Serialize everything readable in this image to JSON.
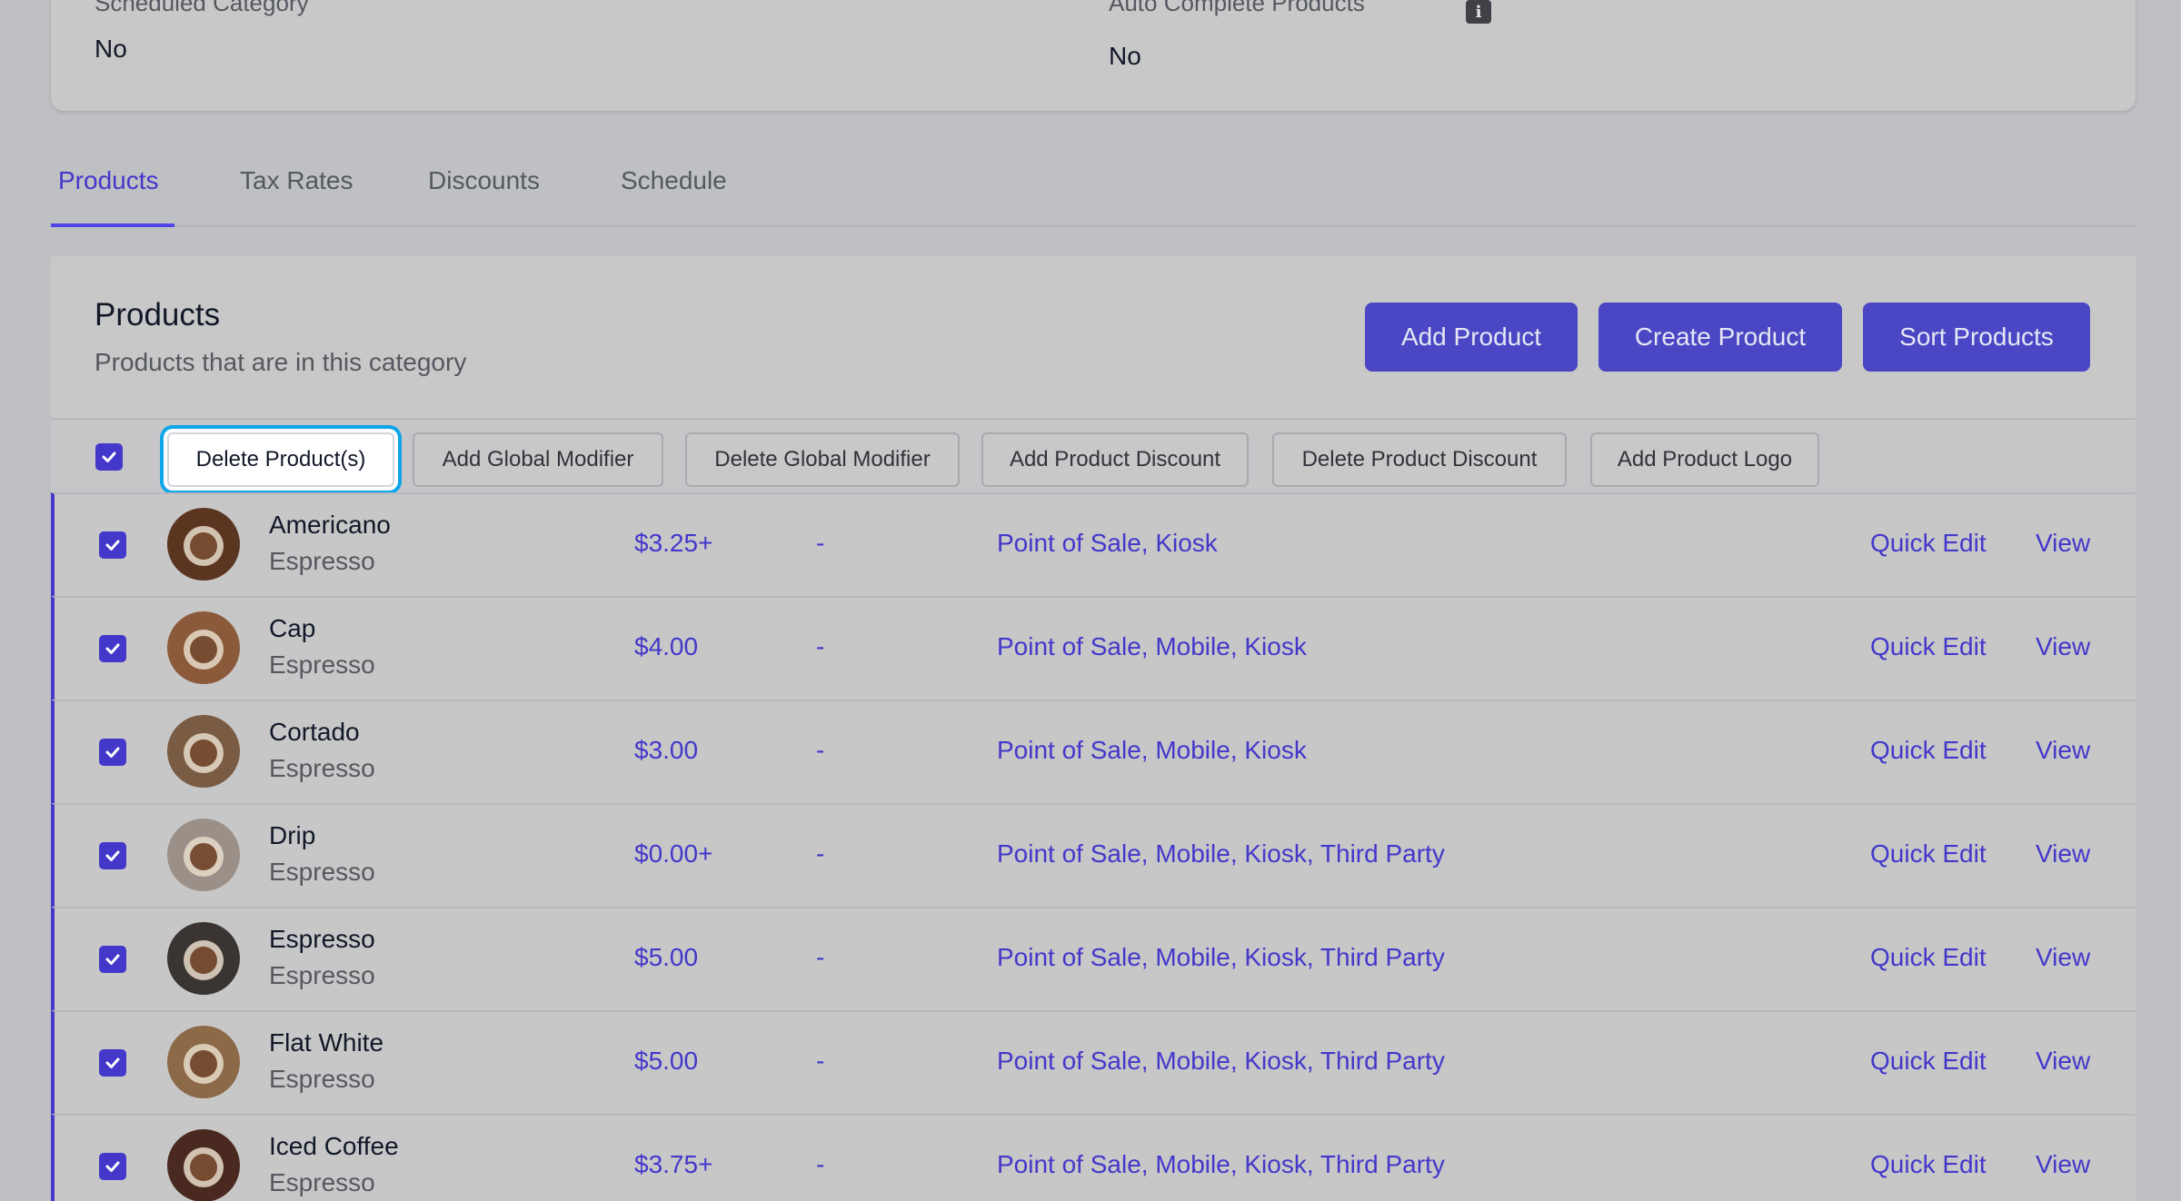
{
  "info": {
    "scheduled_label": "Scheduled Category",
    "scheduled_value": "No",
    "auto_label": "Auto Complete Products",
    "auto_value": "No",
    "info_icon_glyph": "i"
  },
  "tabs": [
    {
      "label": "Products",
      "active": true
    },
    {
      "label": "Tax Rates",
      "active": false
    },
    {
      "label": "Discounts",
      "active": false
    },
    {
      "label": "Schedule",
      "active": false
    }
  ],
  "panel": {
    "title": "Products",
    "subtitle": "Products that are in this category",
    "add_product": "Add Product",
    "create_product": "Create Product",
    "sort_products": "Sort Products"
  },
  "bulk": {
    "delete_products": "Delete Product(s)",
    "add_global_modifier": "Add Global Modifier",
    "delete_global_modifier": "Delete Global Modifier",
    "add_product_discount": "Add Product Discount",
    "delete_product_discount": "Delete Product Discount",
    "add_product_logo": "Add Product Logo"
  },
  "actions": {
    "quick_edit": "Quick Edit",
    "view": "View"
  },
  "products": [
    {
      "name": "Americano",
      "category": "Espresso",
      "price": "$3.25+",
      "dash": "-",
      "channels": "Point of Sale, Kiosk",
      "thumb_color": "#5a3520"
    },
    {
      "name": "Cap",
      "category": "Espresso",
      "price": "$4.00",
      "dash": "-",
      "channels": "Point of Sale, Mobile, Kiosk",
      "thumb_color": "#8a5a3a"
    },
    {
      "name": "Cortado",
      "category": "Espresso",
      "price": "$3.00",
      "dash": "-",
      "channels": "Point of Sale, Mobile, Kiosk",
      "thumb_color": "#7a5c44"
    },
    {
      "name": "Drip",
      "category": "Espresso",
      "price": "$0.00+",
      "dash": "-",
      "channels": "Point of Sale, Mobile, Kiosk, Third Party",
      "thumb_color": "#9a9088"
    },
    {
      "name": "Espresso",
      "category": "Espresso",
      "price": "$5.00",
      "dash": "-",
      "channels": "Point of Sale, Mobile, Kiosk, Third Party",
      "thumb_color": "#3a3433"
    },
    {
      "name": "Flat White",
      "category": "Espresso",
      "price": "$5.00",
      "dash": "-",
      "channels": "Point of Sale, Mobile, Kiosk, Third Party",
      "thumb_color": "#8c6a48"
    },
    {
      "name": "Iced Coffee",
      "category": "Espresso",
      "price": "$3.75+",
      "dash": "-",
      "channels": "Point of Sale, Mobile, Kiosk, Third Party",
      "thumb_color": "#4a2a20"
    }
  ]
}
